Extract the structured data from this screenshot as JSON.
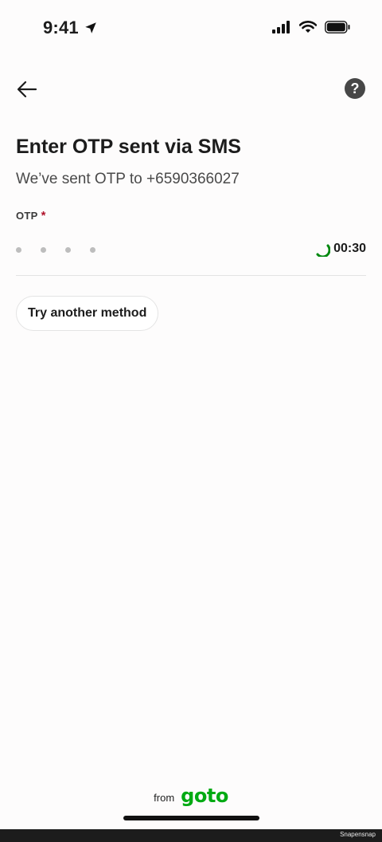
{
  "status_bar": {
    "time": "9:41"
  },
  "header": {
    "help_label": "?"
  },
  "main": {
    "title": "Enter OTP sent via SMS",
    "subtitle": "We’ve sent OTP to +6590366027",
    "otp_label": "OTP",
    "required_mark": "*",
    "otp_digits": 4,
    "timer": "00:30",
    "alt_method_label": "Try another method"
  },
  "footer": {
    "from_label": "from",
    "brand": "goto"
  },
  "watermark": "Snapensnap",
  "colors": {
    "brand_green": "#00aa13",
    "required_red": "#b0132b",
    "help_bg": "#474747"
  },
  "icons": [
    "location-arrow-icon",
    "cellular-signal-icon",
    "wifi-icon",
    "battery-icon",
    "back-arrow-icon",
    "help-icon",
    "timer-ring-icon"
  ]
}
